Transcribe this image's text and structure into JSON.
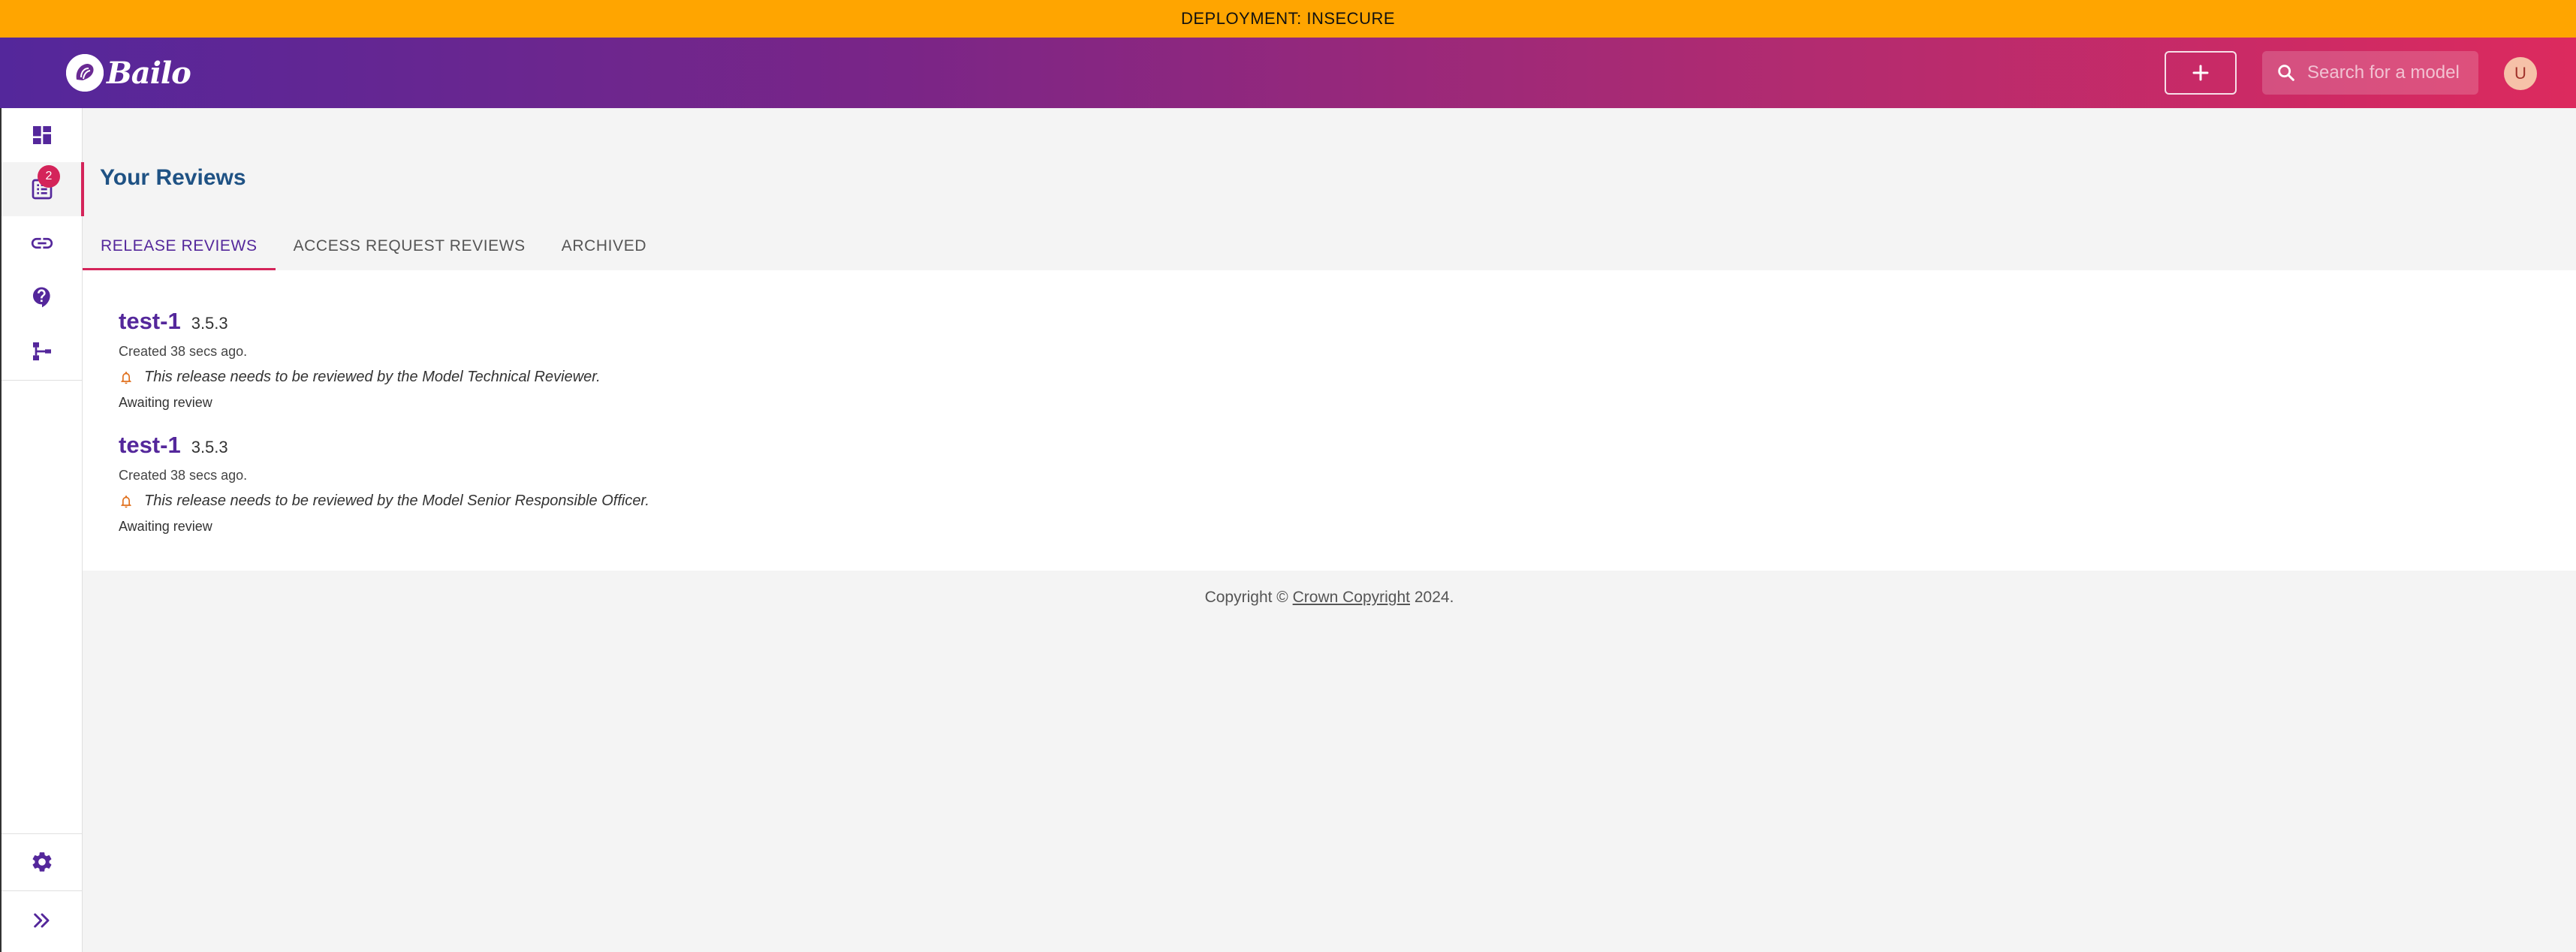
{
  "banner": {
    "text": "DEPLOYMENT: INSECURE"
  },
  "header": {
    "logo_text": "Bailo",
    "search_placeholder": "Search for a model",
    "user_initial": "U"
  },
  "sidebar": {
    "items": [
      {
        "name": "dashboard",
        "icon": "dashboard-icon"
      },
      {
        "name": "reviews",
        "icon": "reviews-list-icon",
        "badge": "2",
        "active": true
      },
      {
        "name": "links",
        "icon": "link-icon"
      },
      {
        "name": "help",
        "icon": "help-icon"
      },
      {
        "name": "schema",
        "icon": "schema-tree-icon"
      }
    ],
    "bottom": [
      {
        "name": "settings",
        "icon": "gear-icon"
      },
      {
        "name": "expand",
        "icon": "double-chevron-right-icon"
      }
    ]
  },
  "main": {
    "title": "Your Reviews",
    "tabs": [
      {
        "label": "RELEASE REVIEWS",
        "active": true
      },
      {
        "label": "ACCESS REQUEST REVIEWS",
        "active": false
      },
      {
        "label": "ARCHIVED",
        "active": false
      }
    ],
    "reviews": [
      {
        "name": "test-1",
        "version": "3.5.3",
        "created": "Created 38 secs ago.",
        "message": "This release needs to be reviewed by the Model Technical Reviewer.",
        "status": "Awaiting review"
      },
      {
        "name": "test-1",
        "version": "3.5.3",
        "created": "Created 38 secs ago.",
        "message": "This release needs to be reviewed by the Model Senior Responsible Officer.",
        "status": "Awaiting review"
      }
    ]
  },
  "footer": {
    "prefix": "Copyright ©",
    "link": "Crown Copyright",
    "suffix": "2024."
  },
  "colors": {
    "banner": "#ffa500",
    "primary": "#54279b",
    "accent": "#d4245a",
    "title": "#1f5284"
  }
}
